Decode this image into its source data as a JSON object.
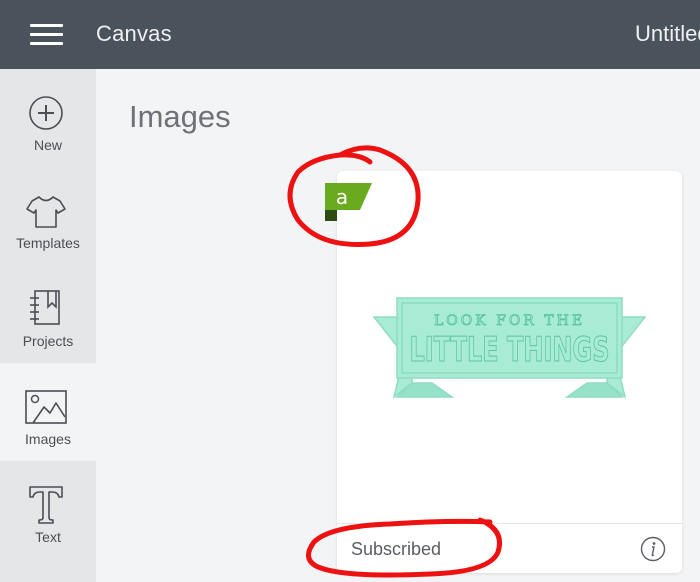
{
  "header": {
    "menu_icon": "hamburger-menu-icon",
    "app_title": "Canvas",
    "document_title": "Untitled"
  },
  "sidebar": {
    "items": [
      {
        "label": "New",
        "icon": "plus-circle-icon",
        "active": false
      },
      {
        "label": "Templates",
        "icon": "tshirt-icon",
        "active": false
      },
      {
        "label": "Projects",
        "icon": "notebook-icon",
        "active": false
      },
      {
        "label": "Images",
        "icon": "image-icon",
        "active": true
      },
      {
        "label": "Text",
        "icon": "text-t-icon",
        "active": false
      }
    ]
  },
  "main": {
    "page_title": "Images",
    "image_card": {
      "badge_letter": "a",
      "badge_color": "#6aaa1e",
      "artwork_text_line1": "LOOK FOR THE",
      "artwork_text_line2": "LITTLE THINGS",
      "artwork_color": "#a8ecd6",
      "status": "Subscribed",
      "info_icon": "info-icon"
    }
  },
  "annotations": {
    "color": "#ee1111"
  }
}
